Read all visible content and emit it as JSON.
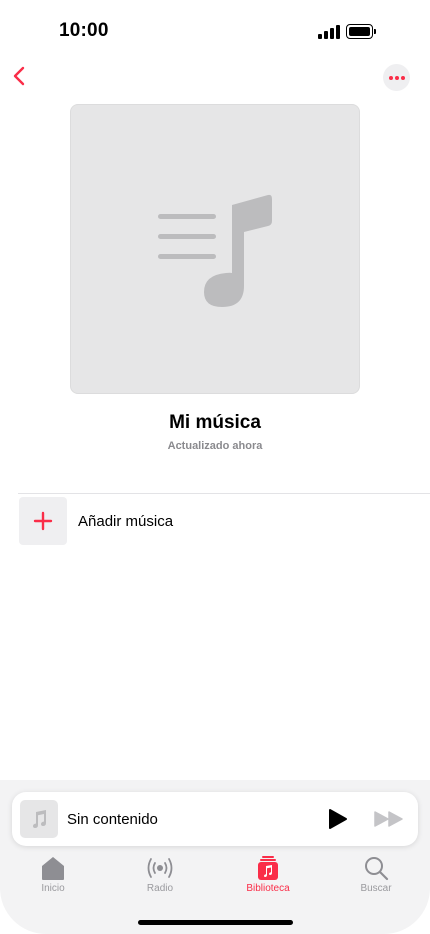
{
  "status_bar": {
    "time": "10:00"
  },
  "nav": {
    "back_icon": "chevron-left-icon",
    "more_icon": "ellipsis-icon"
  },
  "playlist": {
    "title": "Mi música",
    "subtitle": "Actualizado ahora",
    "artwork_icon": "music-list-icon"
  },
  "actions": {
    "add_music_label": "Añadir música",
    "add_icon": "plus-icon"
  },
  "mini_player": {
    "title": "Sin contenido",
    "artwork_icon": "music-note-icon",
    "play_icon": "play-icon",
    "forward_icon": "fast-forward-icon"
  },
  "tabs": [
    {
      "label": "Inicio",
      "icon": "home-icon",
      "active": false
    },
    {
      "label": "Radio",
      "icon": "radio-icon",
      "active": false
    },
    {
      "label": "Biblioteca",
      "icon": "library-icon",
      "active": true
    },
    {
      "label": "Buscar",
      "icon": "search-icon",
      "active": false
    }
  ],
  "colors": {
    "accent": "#fa2d48",
    "inactive": "#9a9a9e",
    "panel": "#f3f3f4"
  }
}
